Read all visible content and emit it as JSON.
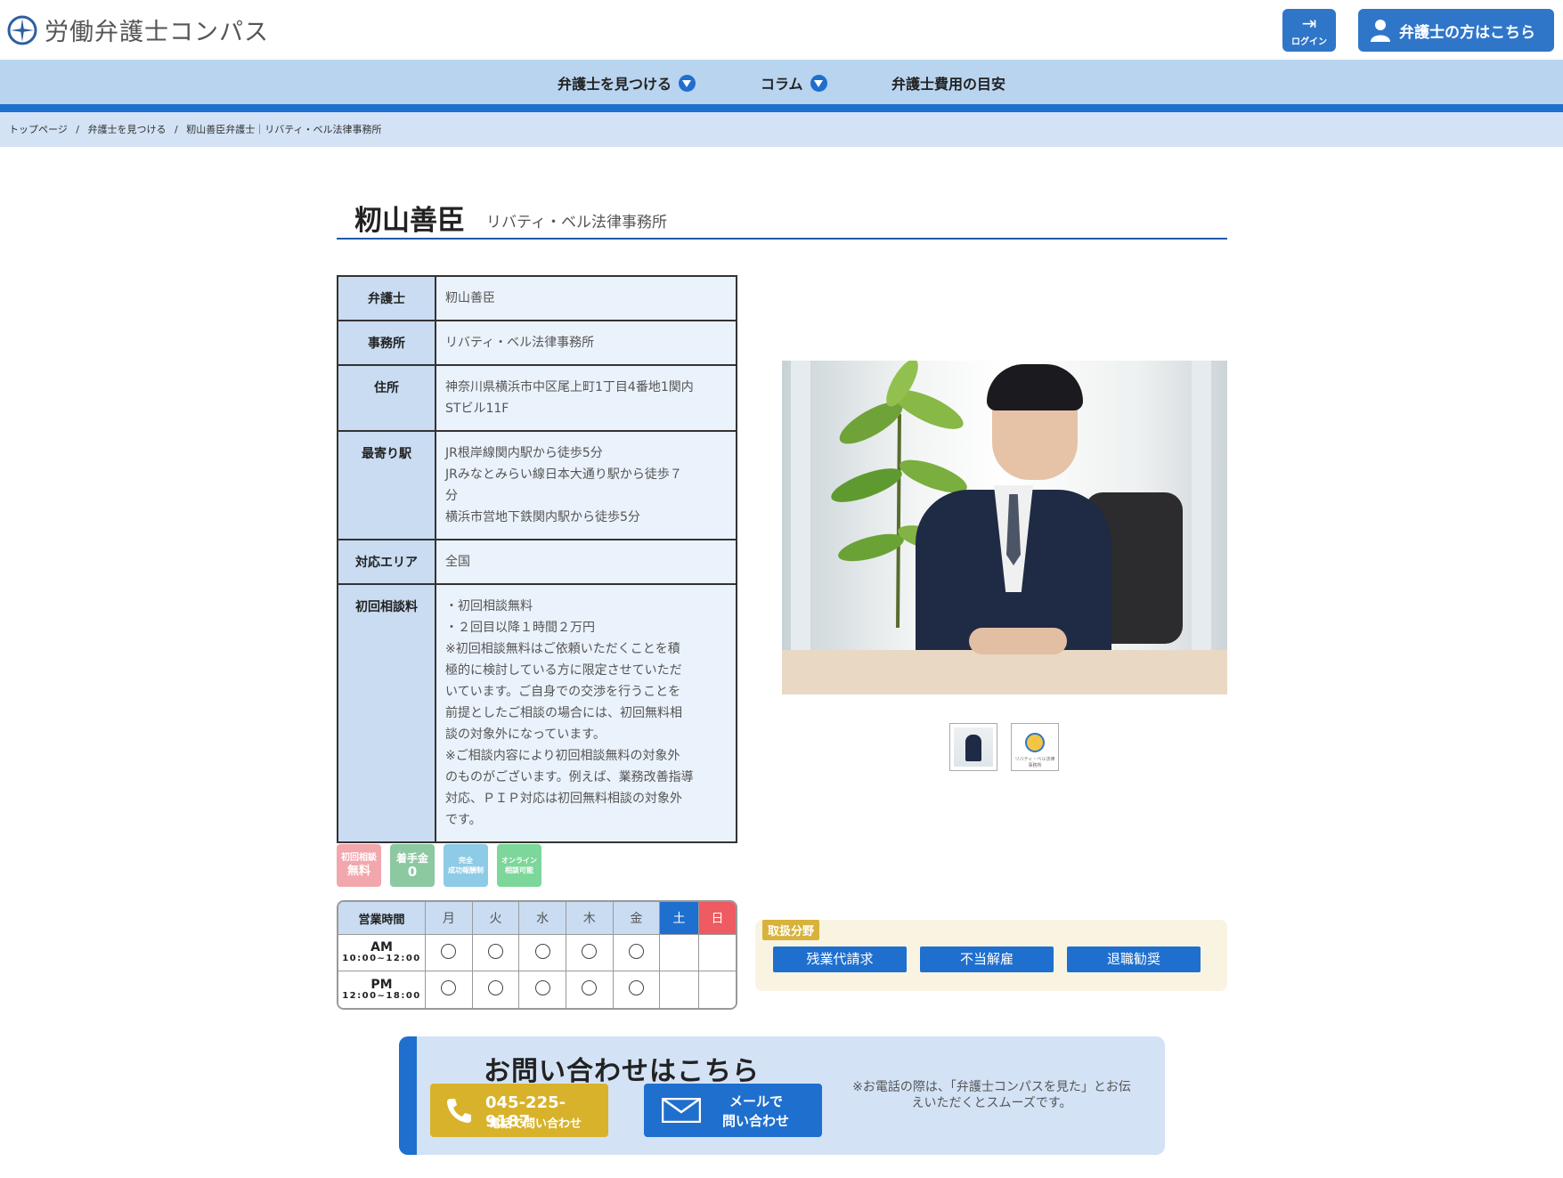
{
  "header": {
    "site_name": "労働弁護士コンパス",
    "login_label": "ログイン",
    "lawyer_button_label": "弁護士の方はこちら"
  },
  "nav": {
    "items": [
      {
        "label": "弁護士を見つける",
        "has_dropdown": true
      },
      {
        "label": "コラム",
        "has_dropdown": true
      },
      {
        "label": "弁護士費用の目安",
        "has_dropdown": false
      }
    ]
  },
  "breadcrumb": [
    "トップページ",
    "弁護士を見つける",
    "籾山善臣弁護士｜リバティ・ベル法律事務所"
  ],
  "profile": {
    "name": "籾山善臣",
    "office": "リバティ・ベル法律事務所"
  },
  "info": {
    "lawyer_label": "弁護士",
    "lawyer_value": "籾山善臣",
    "office_label": "事務所",
    "office_value": "リバティ・ベル法律事務所",
    "address_label": "住所",
    "address_lines": [
      "神奈川県横浜市中区尾上町1丁目4番地1関内",
      "STビル11F"
    ],
    "station_label": "最寄り駅",
    "station_lines": [
      "JR根岸線関内駅から徒歩5分",
      "JRみなとみらい線日本大通り駅から徒歩７",
      "分",
      "横浜市営地下鉄関内駅から徒歩5分"
    ],
    "area_label": "対応エリア",
    "area_value": "全国",
    "fee_label": "初回相談料",
    "fee_lines": [
      "・初回相談無料",
      "・２回目以降１時間２万円",
      "※初回相談無料はご依頼いただくことを積",
      "極的に検討している方に限定させていただ",
      "いています。ご自身での交渉を行うことを",
      "前提としたご相談の場合には、初回無料相",
      "談の対象外になっています。",
      "※ご相談内容により初回相談無料の対象外",
      "のものがございます。例えば、業務改善指導",
      "対応、ＰＩＰ対応は初回無料相談の対象外",
      "です。"
    ]
  },
  "thumbnails": {
    "logo_caption": "リバティ・ベル法律事務所"
  },
  "badges": [
    {
      "line1": "初回相談",
      "line2": "無料",
      "color": "#f2a7ac"
    },
    {
      "line1": "着手金",
      "line2": "0",
      "color": "#8cc8a0"
    },
    {
      "line1": "完全",
      "line2": "成功報酬制",
      "color": "#8dcbe6"
    },
    {
      "line1": "オンライン",
      "line2": "相談可能",
      "color": "#7dd69a"
    }
  ],
  "hours": {
    "header_label": "営業時間",
    "days": [
      "月",
      "火",
      "水",
      "木",
      "金",
      "土",
      "日"
    ],
    "rows": [
      {
        "period": "AM",
        "time": "10:00~12:00",
        "open": [
          true,
          true,
          true,
          true,
          true,
          false,
          false
        ]
      },
      {
        "period": "PM",
        "time": "12:00~18:00",
        "open": [
          true,
          true,
          true,
          true,
          true,
          false,
          false
        ]
      }
    ]
  },
  "specialties": {
    "label": "取扱分野",
    "items": [
      "残業代請求",
      "不当解雇",
      "退職勧奨"
    ]
  },
  "contact": {
    "title": "お問い合わせはこちら",
    "phone_number": "045-225-9187",
    "phone_sub": "電話で問い合わせ",
    "mail_line1": "メールで",
    "mail_line2": "問い合わせ",
    "note_line1": "※お電話の際は、「弁護士コンパスを見た」とお伝",
    "note_line2": "えいただくとスムーズです。"
  },
  "colors": {
    "primary_blue": "#1f6fce",
    "nav_bg": "#b9d4ef",
    "gold": "#d8b22a",
    "sunday_red": "#ee5b62"
  }
}
